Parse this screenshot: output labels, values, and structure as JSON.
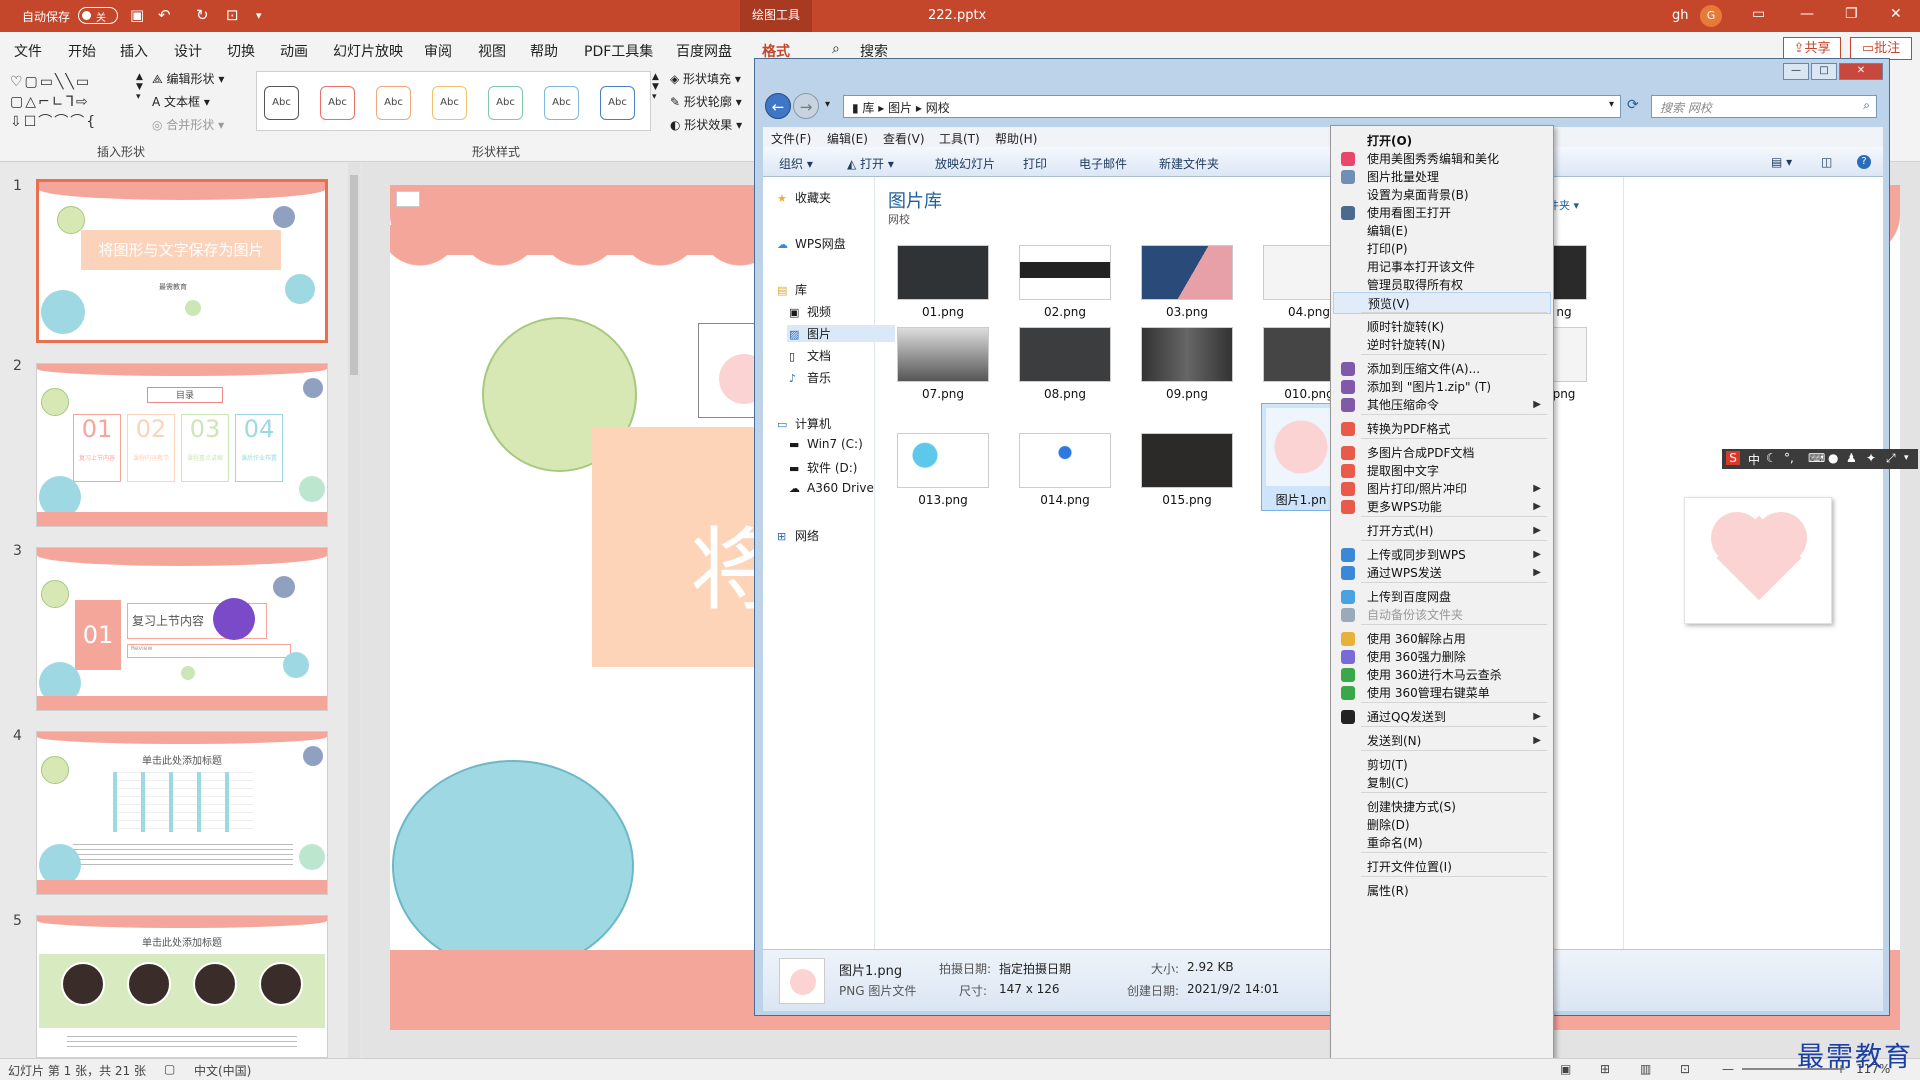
{
  "titlebar": {
    "autosave_label": "自动保存",
    "autosave_state": "关",
    "context_tab": "绘图工具",
    "filename": "222.pptx",
    "user": "gh",
    "avatar": "G"
  },
  "menu": {
    "items": [
      "文件",
      "开始",
      "插入",
      "设计",
      "切换",
      "动画",
      "幻灯片放映",
      "审阅",
      "视图",
      "帮助",
      "PDF工具集",
      "百度网盘",
      "格式"
    ],
    "active": "格式",
    "search_label": "搜索",
    "share": "共享",
    "comment": "批注"
  },
  "ribbon": {
    "edit_shape": "编辑形状",
    "textbox": "文本框",
    "merge_shapes": "合并形状",
    "group_insert": "插入形状",
    "style_label": "Abc",
    "style_colors": [
      "#555555",
      "#e8706a",
      "#f0a878",
      "#f0c06a",
      "#7fc8a9",
      "#7fb8d8",
      "#4a7fbf"
    ],
    "fill": "形状填充",
    "outline": "形状轮廓",
    "effects": "形状效果",
    "group_styles": "形状样式"
  },
  "slides": {
    "numbers": [
      "1",
      "2",
      "3",
      "4",
      "5"
    ],
    "s1_title": "将图形与文字保存为图片",
    "s1_sub": "最需教育",
    "s2_title": "目录",
    "s2_items": [
      "01",
      "02",
      "03",
      "04"
    ],
    "s2_captions": [
      "复习上节内容",
      "课程内容教学",
      "课程重点讲解",
      "课后作业布置"
    ],
    "s3_num": "01",
    "s3_text": "复习上节内容",
    "s3_sub": "Review",
    "s4_title": "单击此处添加标题",
    "s5_title": "单击此处添加标题"
  },
  "main_slide": {
    "big_char": "将"
  },
  "explorer": {
    "address": [
      "库",
      "图片",
      "网校"
    ],
    "search_placeholder": "搜索 网校",
    "menu": [
      "文件(F)",
      "编辑(E)",
      "查看(V)",
      "工具(T)",
      "帮助(H)"
    ],
    "commands": [
      "组织",
      "打开",
      "放映幻灯片",
      "打印",
      "电子邮件",
      "新建文件夹"
    ],
    "nav": {
      "favorites": "收藏夹",
      "wps": "WPS网盘",
      "library": "库",
      "video": "视频",
      "pictures": "图片",
      "docs": "文档",
      "music": "音乐",
      "computer": "计算机",
      "drive_c": "Win7 (C:)",
      "drive_d": "软件 (D:)",
      "drive_a360": "A360 Drive",
      "network": "网络"
    },
    "lib_title": "图片库",
    "lib_sub": "网校",
    "arrange": "件夹",
    "files_row1": [
      "01.png",
      "02.png",
      "03.png",
      "04.png",
      "ng"
    ],
    "files_row2": [
      "07.png",
      "08.png",
      "09.png",
      "010.png",
      "png"
    ],
    "files_row3": [
      "013.png",
      "014.png",
      "015.png",
      "图片1.pn"
    ],
    "details": {
      "name": "图片1.png",
      "type": "PNG 图片文件",
      "date_taken_label": "拍摄日期:",
      "date_taken_value": "指定拍摄日期",
      "dims_label": "尺寸:",
      "dims_value": "147 x 126",
      "size_label": "大小:",
      "size_value": "2.92 KB",
      "created_label": "创建日期:",
      "created_value": "2021/9/2 14:01"
    }
  },
  "context_menu": [
    {
      "label": "打开(O)",
      "bold": true
    },
    {
      "label": "使用美图秀秀编辑和美化",
      "icon": "#e8476b"
    },
    {
      "label": "图片批量处理",
      "icon": "#6f8fb5"
    },
    {
      "label": "设置为桌面背景(B)"
    },
    {
      "label": "使用看图王打开",
      "icon": "#4a6a90"
    },
    {
      "label": "编辑(E)"
    },
    {
      "label": "打印(P)"
    },
    {
      "label": "用记事本打开该文件"
    },
    {
      "label": "管理员取得所有权"
    },
    {
      "label": "预览(V)",
      "hover": true
    },
    {
      "sep": true
    },
    {
      "label": "顺时针旋转(K)"
    },
    {
      "label": "逆时针旋转(N)"
    },
    {
      "sep": true
    },
    {
      "label": "添加到压缩文件(A)...",
      "icon": "#7e5aa8"
    },
    {
      "label": "添加到 \"图片1.zip\" (T)",
      "icon": "#7e5aa8"
    },
    {
      "label": "其他压缩命令",
      "icon": "#7e5aa8",
      "sub": true
    },
    {
      "sep": true
    },
    {
      "label": "转换为PDF格式",
      "icon": "#e85a4a"
    },
    {
      "sep": true
    },
    {
      "label": "多图片合成PDF文档",
      "icon": "#e85a4a"
    },
    {
      "label": "提取图中文字",
      "icon": "#e85a4a"
    },
    {
      "label": "图片打印/照片冲印",
      "icon": "#e85a4a",
      "sub": true
    },
    {
      "label": "更多WPS功能",
      "icon": "#e85a4a",
      "sub": true
    },
    {
      "sep": true
    },
    {
      "label": "打开方式(H)",
      "sub": true
    },
    {
      "sep": true
    },
    {
      "label": "上传或同步到WPS",
      "icon": "#3a88d8",
      "sub": true
    },
    {
      "label": "通过WPS发送",
      "icon": "#3a88d8",
      "sub": true
    },
    {
      "sep": true
    },
    {
      "label": "上传到百度网盘",
      "icon": "#4aa3e0"
    },
    {
      "label": "自动备份该文件夹",
      "icon": "#9ab",
      "disabled": true
    },
    {
      "sep": true
    },
    {
      "label": "使用 360解除占用",
      "icon": "#e8b23a"
    },
    {
      "label": "使用 360强力删除",
      "icon": "#7a6ad8"
    },
    {
      "label": "使用 360进行木马云查杀",
      "icon": "#3aa84a"
    },
    {
      "label": "使用 360管理右键菜单",
      "icon": "#3aa84a"
    },
    {
      "sep": true
    },
    {
      "label": "通过QQ发送到",
      "icon": "#222",
      "sub": true
    },
    {
      "sep": true
    },
    {
      "label": "发送到(N)",
      "sub": true
    },
    {
      "sep": true
    },
    {
      "label": "剪切(T)"
    },
    {
      "label": "复制(C)"
    },
    {
      "sep": true
    },
    {
      "label": "创建快捷方式(S)"
    },
    {
      "label": "删除(D)"
    },
    {
      "label": "重命名(M)"
    },
    {
      "sep": true
    },
    {
      "label": "打开文件位置(I)"
    },
    {
      "sep": true
    },
    {
      "label": "属性(R)"
    }
  ],
  "ime": {
    "brand": "S",
    "lang": "中"
  },
  "status": {
    "slide_info": "幻灯片 第 1 张，共 21 张",
    "lang": "中文(中国)",
    "zoom": "117%"
  },
  "watermark": "最需教育"
}
